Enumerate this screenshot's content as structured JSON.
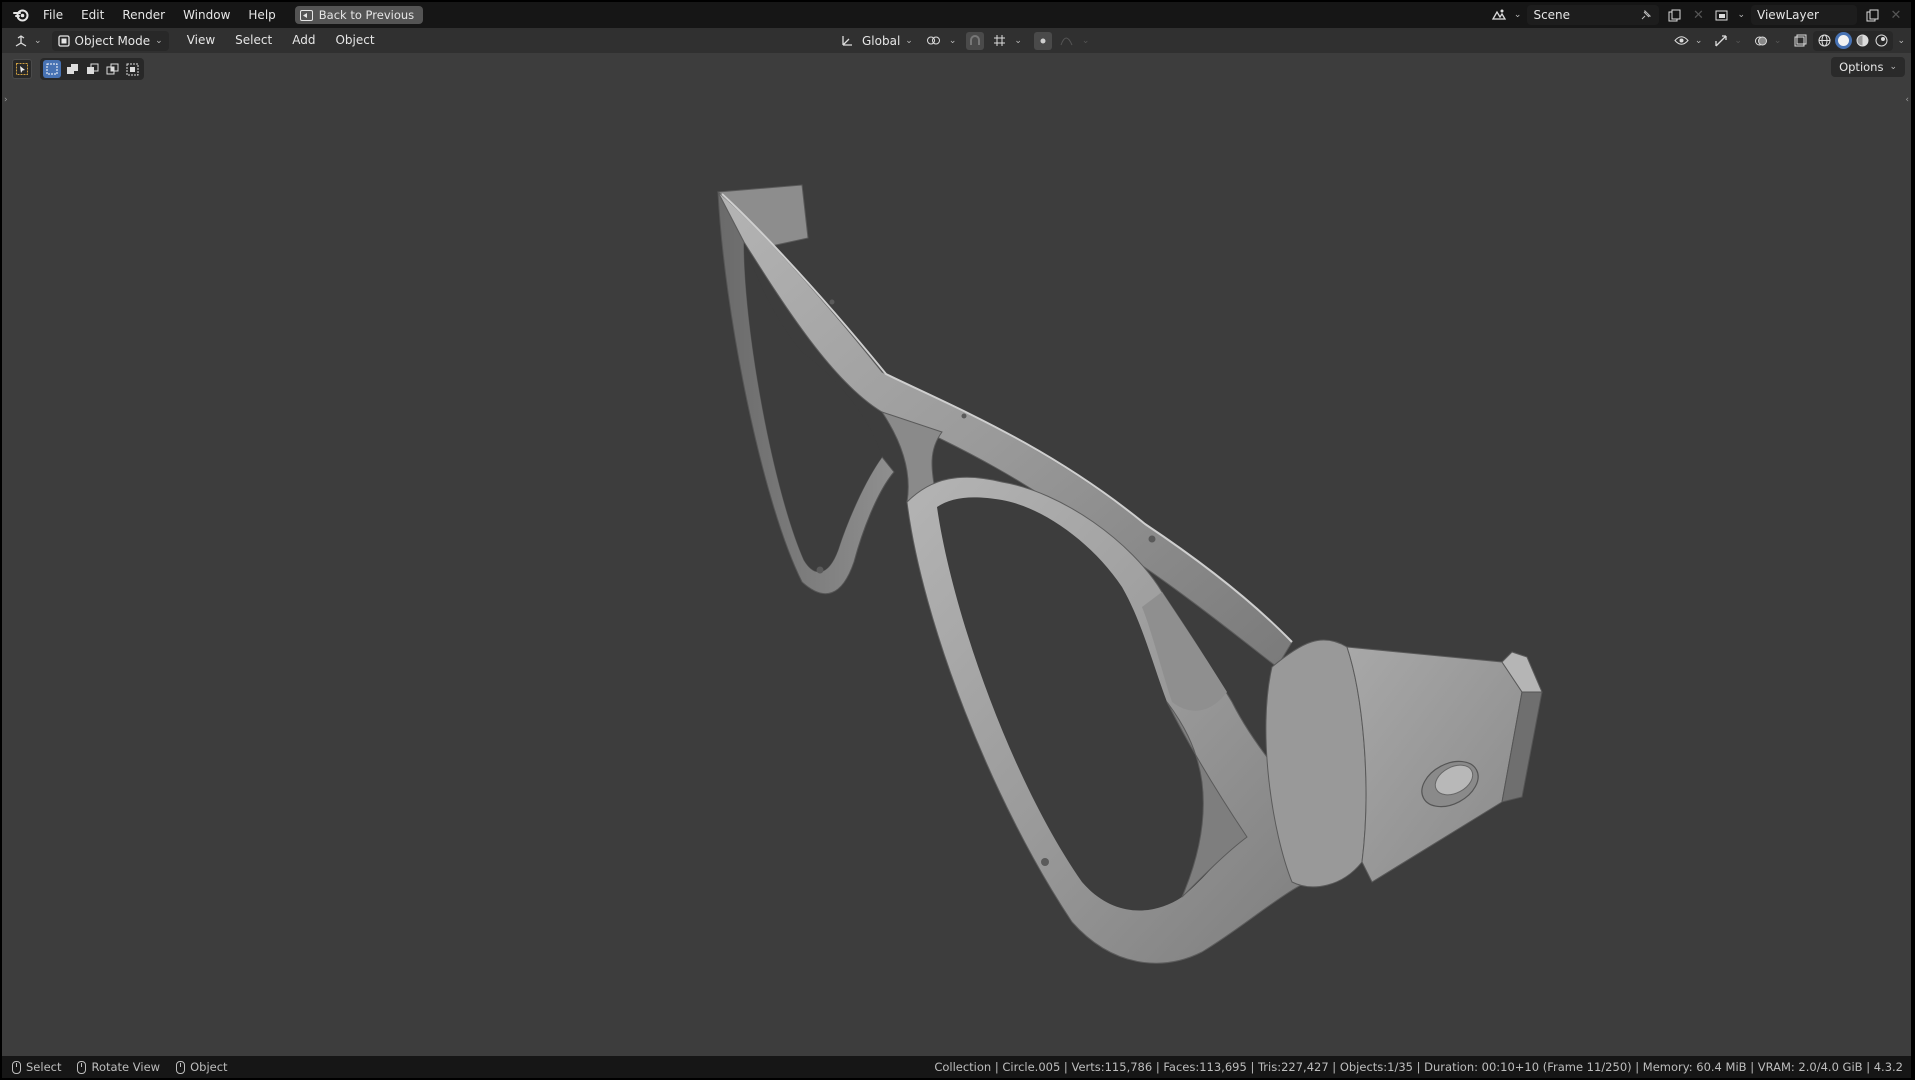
{
  "menubar": {
    "logo_icon": "blender-logo-icon",
    "items": [
      "File",
      "Edit",
      "Render",
      "Window",
      "Help"
    ],
    "back_button": "Back to Previous",
    "scene_label": "Scene",
    "viewlayer_label": "ViewLayer"
  },
  "header": {
    "editor_type_icon": "view3d-icon",
    "mode": "Object Mode",
    "menus": [
      "View",
      "Select",
      "Add",
      "Object"
    ],
    "orientation": "Global"
  },
  "tool_header": {
    "options_label": "Options"
  },
  "statusbar": {
    "select_label": "Select",
    "rotate_label": "Rotate View",
    "object_label": "Object",
    "stats": "Collection | Circle.005 | Verts:115,786 | Faces:113,695 | Tris:227,427 | Objects:1/35 | Duration: 00:10+10 (Frame 11/250) | Memory: 60.4 MiB | VRAM: 2.0/4.0 GiB | 4.3.2"
  },
  "colors": {
    "viewport_bg": "#3d3d3d",
    "topbar_bg": "#161616",
    "header_bg": "#303030",
    "active_blue": "#4772b3",
    "model_grey": "#9b9b9b"
  }
}
